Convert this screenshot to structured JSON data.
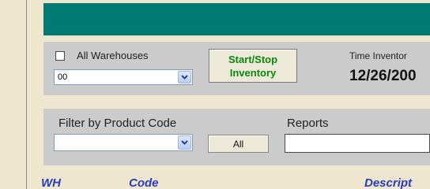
{
  "warehouse": {
    "all_label": "All Warehouses",
    "all_checked": false,
    "selected": "00"
  },
  "start_stop": {
    "line1": "Start/Stop",
    "line2": "Inventory"
  },
  "time_inventory": {
    "label": "Time Inventor",
    "value": "12/26/200"
  },
  "filter": {
    "label": "Filter by Product Code",
    "selected": "",
    "all_button": "All"
  },
  "reports": {
    "label": "Reports",
    "value": ""
  },
  "columns": [
    "WH",
    "Code",
    "Descript"
  ],
  "colors": {
    "background": "#efe6cf",
    "banner": "#007b73",
    "panel": "#cbcbcb",
    "start_button_text": "#0a8a0a",
    "column_header": "#2a3bbd"
  }
}
